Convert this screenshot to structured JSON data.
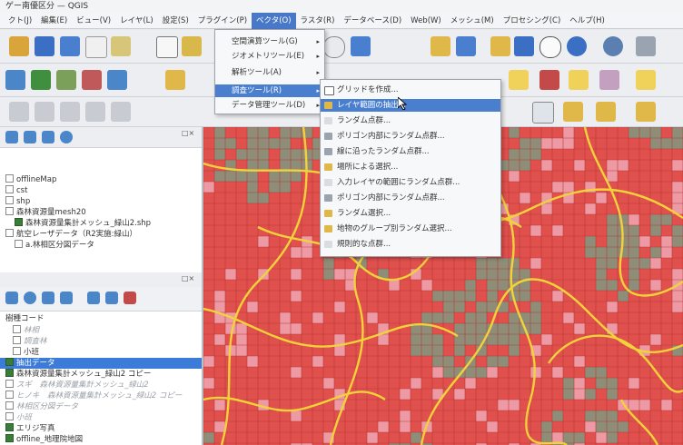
{
  "window": {
    "title": "ゲー南優区分 — QGIS"
  },
  "menubar": {
    "items": [
      {
        "id": "project",
        "label": "クト(J)"
      },
      {
        "id": "edit",
        "label": "編集(E)"
      },
      {
        "id": "view",
        "label": "ビュー(V)"
      },
      {
        "id": "layer",
        "label": "レイヤ(L)"
      },
      {
        "id": "settings",
        "label": "設定(S)"
      },
      {
        "id": "plugins",
        "label": "プラグイン(P)"
      },
      {
        "id": "vector",
        "label": "ベクタ(O)"
      },
      {
        "id": "raster",
        "label": "ラスタ(R)"
      },
      {
        "id": "database",
        "label": "データベース(D)"
      },
      {
        "id": "web",
        "label": "Web(W)"
      },
      {
        "id": "mesh",
        "label": "メッシュ(M)"
      },
      {
        "id": "processing",
        "label": "プロセシング(C)"
      },
      {
        "id": "help",
        "label": "ヘルプ(H)"
      }
    ]
  },
  "vector_menu": {
    "items": [
      {
        "label": "空間演算ツール(G)",
        "arrow": "▸"
      },
      {
        "label": "ジオメトリツール(E)",
        "arrow": "▸"
      },
      {
        "label": "解析ツール(A)",
        "arrow": "▸"
      },
      {
        "label": "調査ツール(R)",
        "arrow": "▸"
      },
      {
        "label": "データ管理ツール(D)",
        "arrow": "▸"
      }
    ]
  },
  "research_submenu": {
    "items": [
      {
        "label": "グリッドを作成..."
      },
      {
        "label": "レイヤ範囲の抽出..."
      },
      {
        "label": "ランダム点群..."
      },
      {
        "label": "ポリゴン内部にランダム点群..."
      },
      {
        "label": "線に沿ったランダム点群..."
      },
      {
        "label": "場所による選択..."
      },
      {
        "label": "入力レイヤの範囲にランダム点群..."
      },
      {
        "label": "ポリゴン内部にランダム点群..."
      },
      {
        "label": "ランダム選択..."
      },
      {
        "label": "地物のグループ別ランダム選択..."
      },
      {
        "label": "規則的な点群..."
      }
    ]
  },
  "layers_panel": {
    "items": [
      {
        "label": "offlineMap",
        "style": "normal"
      },
      {
        "label": "cst",
        "style": "normal"
      },
      {
        "label": "shp",
        "style": "normal"
      },
      {
        "label": "森林資源量mesh20",
        "style": "normal"
      },
      {
        "label": "森林資源量集計メッシュ_緑山2.shp",
        "style": "normal"
      },
      {
        "label": "航空レーザデータ（R2実施:緑山）",
        "style": "normal"
      },
      {
        "label": "a.林相区分図データ",
        "style": "normal"
      }
    ]
  },
  "legend_panel": {
    "items": [
      {
        "label": "樹種コード",
        "style": "normal",
        "checked": false
      },
      {
        "label": "林相",
        "style": "faded",
        "checked": false
      },
      {
        "label": "調査林",
        "style": "faded",
        "checked": false
      },
      {
        "label": "小班",
        "style": "normal",
        "checked": false
      },
      {
        "label": "抽出データ",
        "style": "selected",
        "checked": false
      },
      {
        "label": "森林資源量集計メッシュ_緑山2 コピー",
        "style": "normal",
        "checked": true
      },
      {
        "label": "スギ　森林資源量集計メッシュ_緑山2",
        "style": "faded",
        "checked": false
      },
      {
        "label": "ヒノキ　森林資源量集計メッシュ_緑山2 コピー",
        "style": "faded",
        "checked": false
      },
      {
        "label": "林相区分図データ",
        "style": "faded",
        "checked": false
      },
      {
        "label": "小班",
        "style": "faded",
        "checked": false
      },
      {
        "label": "エリジ写真",
        "style": "normal",
        "checked": false
      },
      {
        "label": "offline_地理院地図",
        "style": "normal",
        "checked": false
      }
    ]
  },
  "colors": {
    "map_red": "#e0504c",
    "map_pink": "#ee9aa4",
    "map_grey": "#8e8e78",
    "map_yellow": "#f2d23a",
    "menu_highlight": "#4a7fd0"
  },
  "icons": [
    "hand-pan-icon",
    "save-icon",
    "open-icon",
    "refresh-icon",
    "zoom-icon",
    "clock-icon",
    "measure-icon",
    "search-icon",
    "filter-icon",
    "add-layer-icon"
  ]
}
